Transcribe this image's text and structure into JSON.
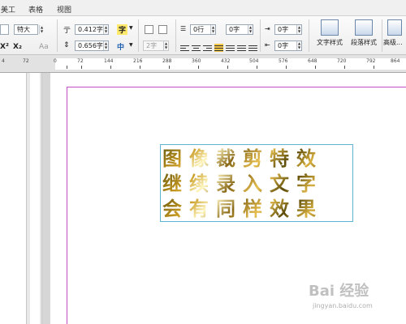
{
  "menu": {
    "items": [
      "美工",
      "表格",
      "视图"
    ]
  },
  "ribbon": {
    "font_size": "特大",
    "char_spacing": "0.412字",
    "line_spacing": "0.656字",
    "char_icon": "字",
    "zhong_icon": "中",
    "para_indent": "2字",
    "space_before": "0行",
    "space_after": "0字",
    "indent_right": "0字",
    "indent_left": "0字",
    "superscript": "X²",
    "subscript": "X₂",
    "font_size_label": "Aa",
    "text_style_label": "文字样式",
    "para_style_label": "段落样式",
    "advanced_label": "高级..."
  },
  "ruler": {
    "labels": [
      "4",
      "72",
      "0",
      "72",
      "144",
      "216",
      "288",
      "360",
      "432",
      "504",
      "576",
      "648",
      "720",
      "792",
      "864"
    ]
  },
  "document": {
    "lines": [
      "图像裁剪特效",
      "继续录入文字",
      "会有同样效果"
    ]
  },
  "watermark": {
    "brand": "Bai 经验",
    "url": "jingyan.baidu.com"
  },
  "colors": {
    "frame": "#5fb3d6",
    "margin_guide": "#c24fc8"
  }
}
